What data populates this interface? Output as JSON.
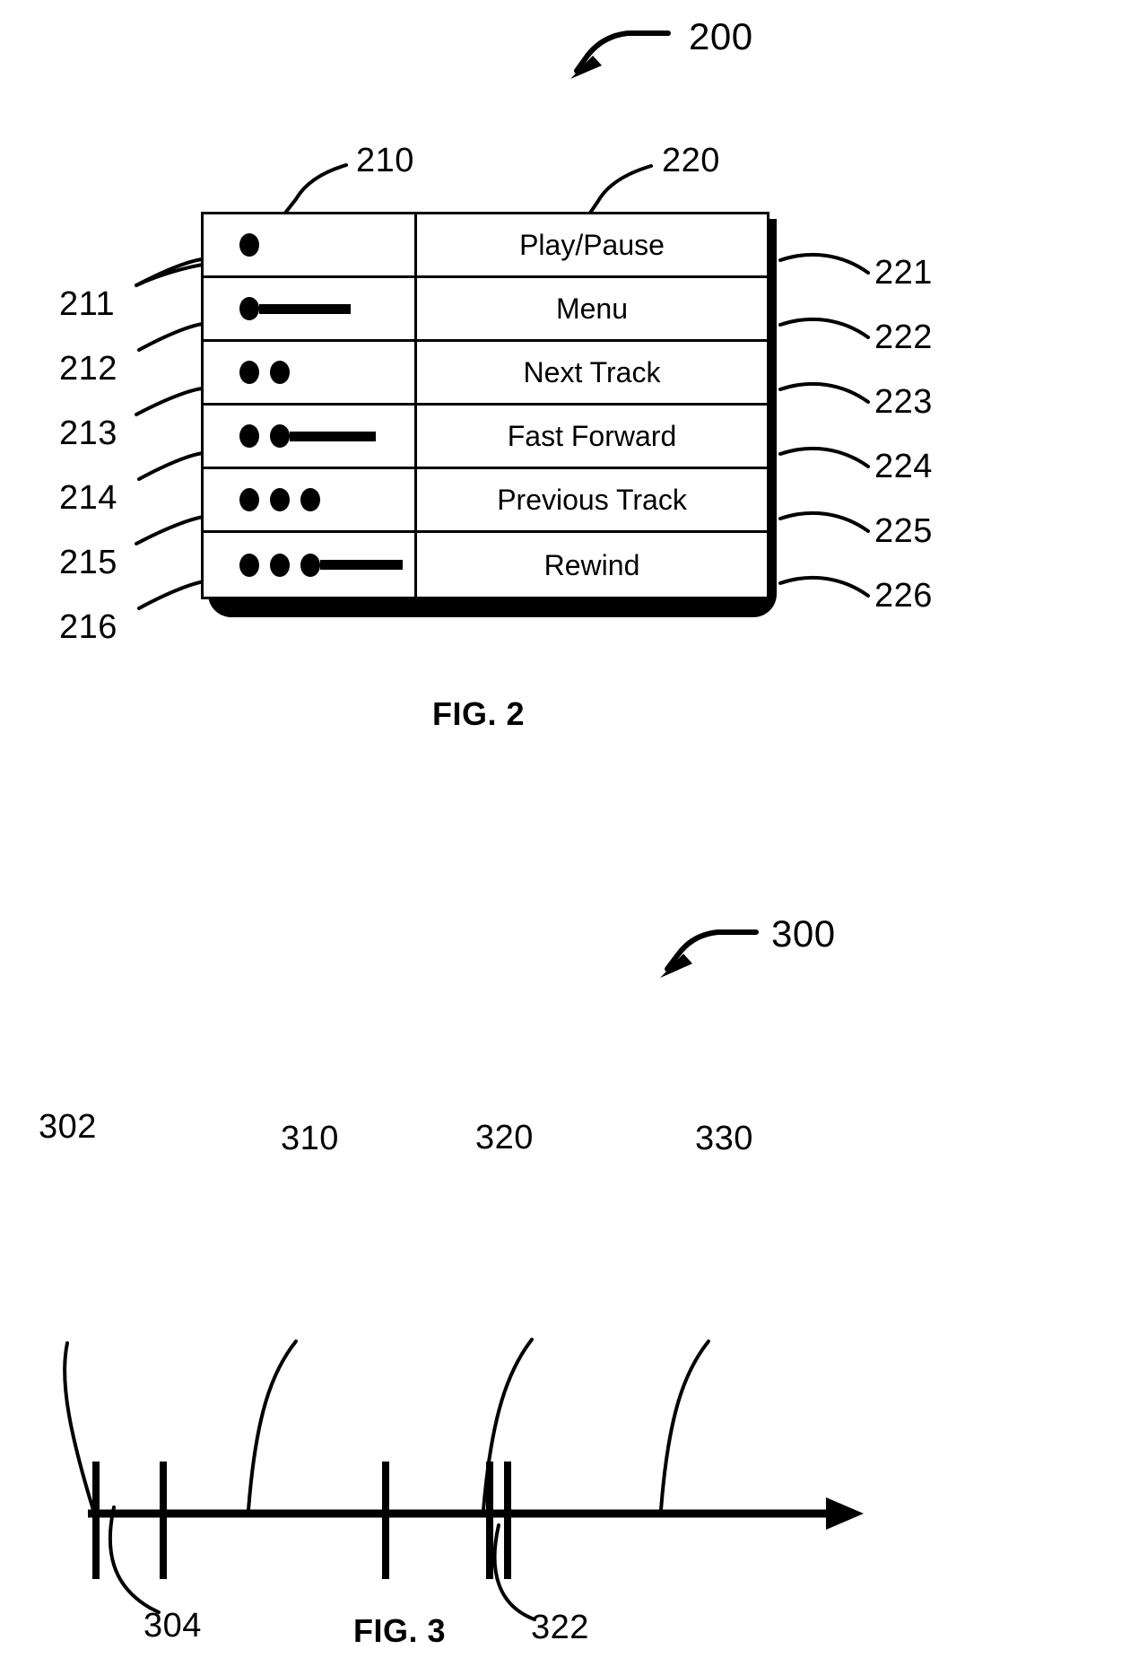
{
  "sheet": {
    "figure2": {
      "assembly_ref": "200",
      "table_ref_left": "210",
      "table_ref_right": "220",
      "caption": "FIG. 2",
      "columns": [
        "gesture-pattern",
        "command-label"
      ],
      "rows": [
        {
          "left_ref": "211",
          "right_ref": "221",
          "pattern": "tap",
          "dots": 1,
          "hold": false,
          "label": "Play/Pause"
        },
        {
          "left_ref": "212",
          "right_ref": "222",
          "pattern": "tap-hold",
          "dots": 1,
          "hold": true,
          "label": "Menu"
        },
        {
          "left_ref": "213",
          "right_ref": "223",
          "pattern": "double-tap",
          "dots": 2,
          "hold": false,
          "label": "Next Track"
        },
        {
          "left_ref": "214",
          "right_ref": "224",
          "pattern": "double-tap-hold",
          "dots": 2,
          "hold": true,
          "label": "Fast Forward"
        },
        {
          "left_ref": "215",
          "right_ref": "225",
          "pattern": "triple-tap",
          "dots": 3,
          "hold": false,
          "label": "Previous Track"
        },
        {
          "left_ref": "216",
          "right_ref": "226",
          "pattern": "triple-tap-hold",
          "dots": 3,
          "hold": true,
          "label": "Rewind"
        }
      ]
    },
    "figure3": {
      "assembly_ref": "300",
      "caption": "FIG. 3",
      "timeline_refs": [
        {
          "ref": "302",
          "position": "first-tick",
          "side": "above-left"
        },
        {
          "ref": "304",
          "position": "first-gap",
          "side": "below-left"
        },
        {
          "ref": "310",
          "position": "first-interval",
          "side": "above"
        },
        {
          "ref": "320",
          "position": "second-interval",
          "side": "above"
        },
        {
          "ref": "322",
          "position": "double-tick-pair",
          "side": "below"
        },
        {
          "ref": "330",
          "position": "third-interval",
          "side": "above"
        }
      ]
    }
  },
  "style": {
    "ink": "#000000",
    "paper": "#ffffff"
  }
}
